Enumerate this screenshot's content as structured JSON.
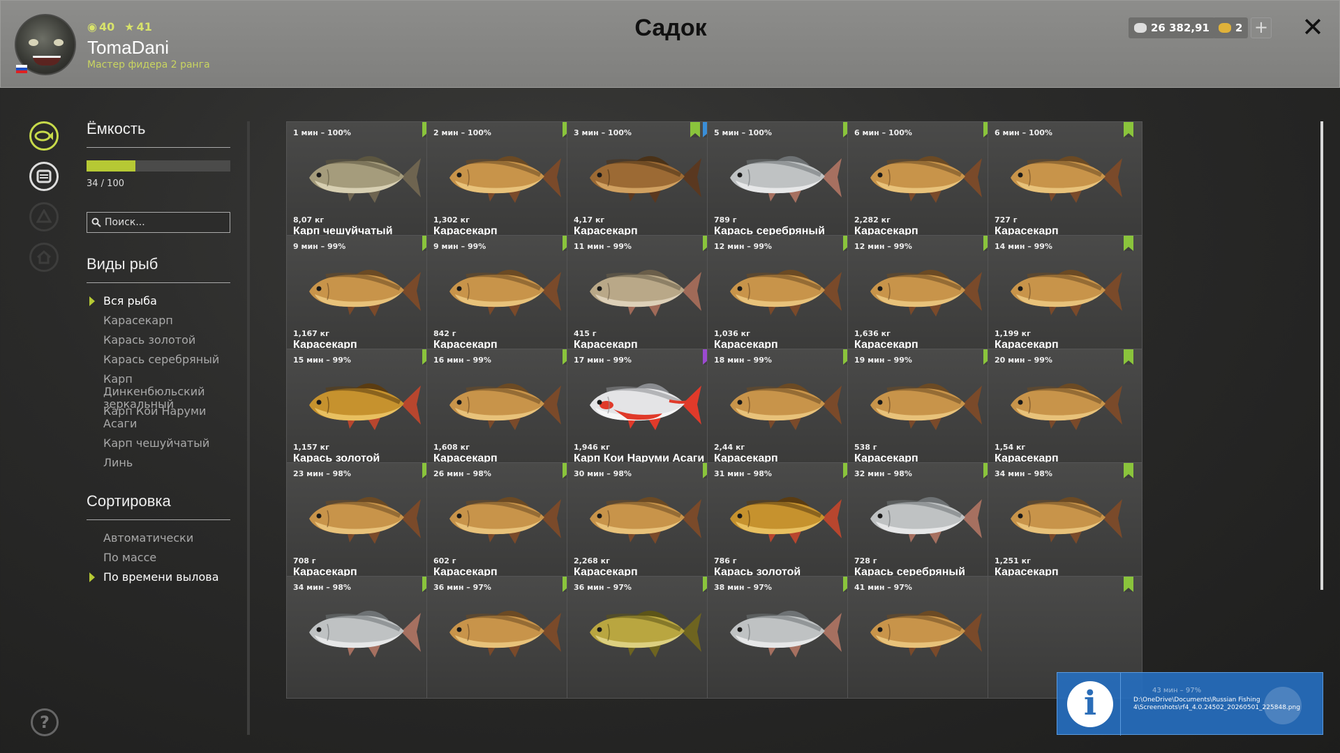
{
  "header": {
    "window_title": "Садок",
    "player": {
      "level": "40",
      "stars": "41",
      "name": "TomaDani",
      "rank": "Мастер фидера 2 ранга"
    },
    "silver": "26 382,91",
    "gold": "2",
    "plus_label": "+",
    "close_label": "✕"
  },
  "sidebar": {
    "capacity_title": "Ёмкость",
    "capacity_used": 34,
    "capacity_max": 100,
    "capacity_text": "34 / 100",
    "search_placeholder": "Поиск...",
    "species_title": "Виды рыб",
    "species": [
      "Вся рыба",
      "Карасекарп",
      "Карась золотой",
      "Карась серебряный",
      "Карп Динкенбюльский зеркальный",
      "Карп Кои Наруми Асаги",
      "Карп чешуйчатый",
      "Линь"
    ],
    "species_selected": 0,
    "sort_title": "Сортировка",
    "sorts": [
      "Автоматически",
      "По массе",
      "По времени вылова"
    ],
    "sort_selected": 2,
    "help_label": "?"
  },
  "nav_icons": [
    "fish-icon",
    "keepnet-icon",
    "tackle-icon",
    "home-icon"
  ],
  "cards": [
    {
      "time": "1 мин – 100%",
      "weight": "8,07 кг",
      "name": "Карп чешуйчатый",
      "fish": "carp",
      "marks": [
        "green"
      ]
    },
    {
      "time": "2 мин – 100%",
      "weight": "1,302 кг",
      "name": "Карасекарп",
      "fish": "hybrid",
      "marks": [
        "green"
      ]
    },
    {
      "time": "3 мин – 100%",
      "weight": "4,17 кг",
      "name": "Карасекарп",
      "fish": "hybrid-dark",
      "marks": [
        "green",
        "blue"
      ]
    },
    {
      "time": "5 мин – 100%",
      "weight": "789 г",
      "name": "Карась серебряный",
      "fish": "silver",
      "marks": [
        "green"
      ]
    },
    {
      "time": "6 мин – 100%",
      "weight": "2,282 кг",
      "name": "Карасекарп",
      "fish": "hybrid",
      "marks": [
        "green"
      ]
    },
    {
      "time": "6 мин – 100%",
      "weight": "727 г",
      "name": "Карасекарп",
      "fish": "hybrid",
      "marks": [
        "green"
      ]
    },
    {
      "time": "9 мин – 99%",
      "weight": "1,167 кг",
      "name": "Карасекарп",
      "fish": "hybrid",
      "marks": [
        "green"
      ]
    },
    {
      "time": "9 мин – 99%",
      "weight": "842 г",
      "name": "Карасекарп",
      "fish": "hybrid",
      "marks": [
        "green"
      ]
    },
    {
      "time": "11 мин – 99%",
      "weight": "415 г",
      "name": "Карасекарп",
      "fish": "hybrid-pale",
      "marks": [
        "green"
      ]
    },
    {
      "time": "12 мин – 99%",
      "weight": "1,036 кг",
      "name": "Карасекарп",
      "fish": "hybrid",
      "marks": [
        "green"
      ]
    },
    {
      "time": "12 мин – 99%",
      "weight": "1,636 кг",
      "name": "Карасекарп",
      "fish": "hybrid",
      "marks": [
        "green"
      ]
    },
    {
      "time": "14 мин – 99%",
      "weight": "1,199 кг",
      "name": "Карасекарп",
      "fish": "hybrid",
      "marks": [
        "green"
      ]
    },
    {
      "time": "15 мин – 99%",
      "weight": "1,157 кг",
      "name": "Карась золотой",
      "fish": "golden",
      "marks": [
        "green"
      ]
    },
    {
      "time": "16 мин – 99%",
      "weight": "1,608 кг",
      "name": "Карасекарп",
      "fish": "hybrid",
      "marks": [
        "green"
      ]
    },
    {
      "time": "17 мин – 99%",
      "weight": "1,946 кг",
      "name": "Карп Кои Наруми Асаги",
      "fish": "koi",
      "marks": [
        "purple"
      ]
    },
    {
      "time": "18 мин – 99%",
      "weight": "2,44 кг",
      "name": "Карасекарп",
      "fish": "hybrid",
      "marks": [
        "green"
      ]
    },
    {
      "time": "19 мин – 99%",
      "weight": "538 г",
      "name": "Карасекарп",
      "fish": "hybrid",
      "marks": [
        "green"
      ]
    },
    {
      "time": "20 мин – 99%",
      "weight": "1,54 кг",
      "name": "Карасекарп",
      "fish": "hybrid",
      "marks": [
        "green"
      ]
    },
    {
      "time": "23 мин – 98%",
      "weight": "708 г",
      "name": "Карасекарп",
      "fish": "hybrid",
      "marks": [
        "green"
      ]
    },
    {
      "time": "26 мин – 98%",
      "weight": "602 г",
      "name": "Карасекарп",
      "fish": "hybrid",
      "marks": [
        "green"
      ]
    },
    {
      "time": "30 мин – 98%",
      "weight": "2,268 кг",
      "name": "Карасекарп",
      "fish": "hybrid",
      "marks": [
        "green"
      ]
    },
    {
      "time": "31 мин – 98%",
      "weight": "786 г",
      "name": "Карась золотой",
      "fish": "golden",
      "marks": [
        "green"
      ]
    },
    {
      "time": "32 мин – 98%",
      "weight": "728 г",
      "name": "Карась серебряный",
      "fish": "silver",
      "marks": [
        "green"
      ]
    },
    {
      "time": "34 мин – 98%",
      "weight": "1,251 кг",
      "name": "Карасекарп",
      "fish": "hybrid",
      "marks": [
        "green"
      ]
    },
    {
      "time": "34 мин – 98%",
      "weight": "",
      "name": "",
      "fish": "silver",
      "marks": [
        "green"
      ]
    },
    {
      "time": "36 мин – 97%",
      "weight": "",
      "name": "",
      "fish": "hybrid",
      "marks": [
        "green"
      ]
    },
    {
      "time": "36 мин – 97%",
      "weight": "",
      "name": "",
      "fish": "tench",
      "marks": [
        "green"
      ]
    },
    {
      "time": "38 мин – 97%",
      "weight": "",
      "name": "",
      "fish": "silver",
      "marks": [
        "green"
      ]
    },
    {
      "time": "41 мин – 97%",
      "weight": "",
      "name": "",
      "fish": "hybrid",
      "marks": []
    },
    {
      "time": "",
      "weight": "",
      "name": "",
      "fish": "",
      "marks": [
        "green"
      ]
    }
  ],
  "notification": {
    "faded": "43 мин – 97%",
    "path": "D:\\OneDrive\\Documents\\Russian Fishing 4\\Screenshots\\rf4_4.0.24502_20260501_225848.png"
  },
  "colors": {
    "accent": "#b6c934",
    "mark_green": "#8ac43c",
    "mark_blue": "#3a8ed8",
    "mark_purple": "#9b4ad0",
    "toast": "#2a6db8"
  },
  "fish_palettes": {
    "hybrid": {
      "body": "#c8944a",
      "belly": "#e8c27a",
      "back": "#6b4a24",
      "fin": "#7a4a2a"
    },
    "hybrid-dark": {
      "body": "#9c6a34",
      "belly": "#d0a060",
      "back": "#4a3218",
      "fin": "#5a3820"
    },
    "hybrid-pale": {
      "body": "#b9a888",
      "belly": "#ddd0b8",
      "back": "#6a5e4a",
      "fin": "#a06a58"
    },
    "carp": {
      "body": "#a59c7c",
      "belly": "#d7cfb2",
      "back": "#5c5640",
      "fin": "#6e6450"
    },
    "silver": {
      "body": "#bfc2c3",
      "belly": "#e6e7e8",
      "back": "#6e7274",
      "fin": "#a67060"
    },
    "golden": {
      "body": "#c6922e",
      "belly": "#e8c060",
      "back": "#5a3c12",
      "fin": "#b8462e"
    },
    "koi": {
      "body": "#e4e4e6",
      "belly": "#f6f6f6",
      "back": "#8a8c90",
      "fin": "#e03a2a"
    },
    "tench": {
      "body": "#b9a640",
      "belly": "#ddd080",
      "back": "#5c5418",
      "fin": "#6e6420"
    }
  }
}
